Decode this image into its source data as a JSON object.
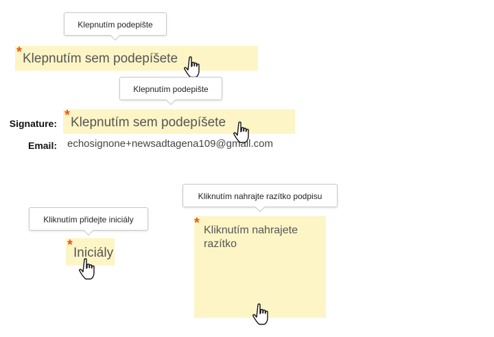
{
  "signature_top": {
    "tooltip": "Klepnutím podepište",
    "required_marker": "*",
    "placeholder": "Klepnutím sem podepíšete"
  },
  "signature_main": {
    "tooltip": "Klepnutím podepište",
    "required_marker": "*",
    "placeholder": "Klepnutím sem podepíšete",
    "label": "Signature:"
  },
  "email": {
    "label": "Email:",
    "value": "echosignone+newsadtagena109@gmail.com"
  },
  "initials": {
    "tooltip": "Kliknutím přidejte iniciály",
    "required_marker": "*",
    "placeholder": "Iniciály"
  },
  "stamp": {
    "tooltip": "Kliknutím nahrajte razítko podpisu",
    "required_marker": "*",
    "placeholder": "Kliknutím nahrajete razítko"
  },
  "colors": {
    "field_bg": "#fdf5c6",
    "required": "#e8541c"
  },
  "icons": [
    "hand-pointer-icon"
  ]
}
